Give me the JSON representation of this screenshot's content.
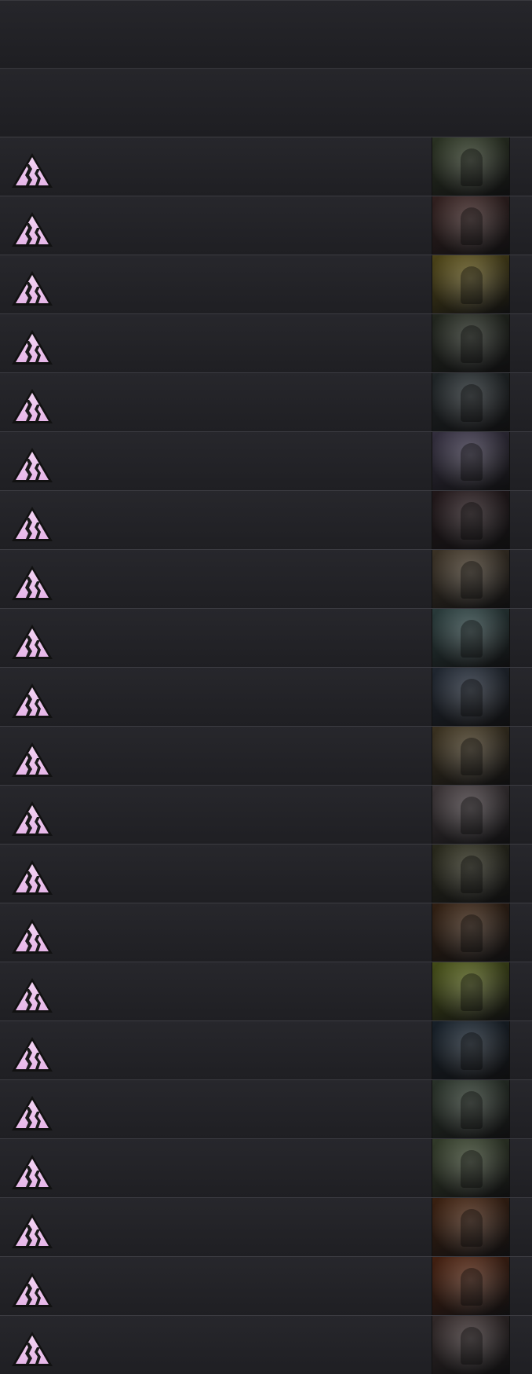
{
  "header": {
    "rows": [
      "",
      ""
    ]
  },
  "rarity_icon": "rarity-triangle-icon",
  "colors": {
    "background": "#212125",
    "row_border": "#3c3c42",
    "rarity_fill": "#e6b6e8"
  },
  "cards": [
    {
      "art": "#4c5a3e"
    },
    {
      "art": "#5a3a38"
    },
    {
      "art": "#8a7a2a"
    },
    {
      "art": "#3e4638"
    },
    {
      "art": "#3a4448"
    },
    {
      "art": "#5c5470"
    },
    {
      "art": "#3c2a2e"
    },
    {
      "art": "#6a5a44"
    },
    {
      "art": "#4a6a6a"
    },
    {
      "art": "#3a4658"
    },
    {
      "art": "#6a5a3a"
    },
    {
      "art": "#6a5e62"
    },
    {
      "art": "#4a4a32"
    },
    {
      "art": "#5a3a22"
    },
    {
      "art": "#7a8a2a"
    },
    {
      "art": "#2a3a4a"
    },
    {
      "art": "#4a5a4a"
    },
    {
      "art": "#5a6a4a"
    },
    {
      "art": "#6a3a1e"
    },
    {
      "art": "#7a3a1e"
    },
    {
      "art": "#5a4a4a"
    }
  ]
}
